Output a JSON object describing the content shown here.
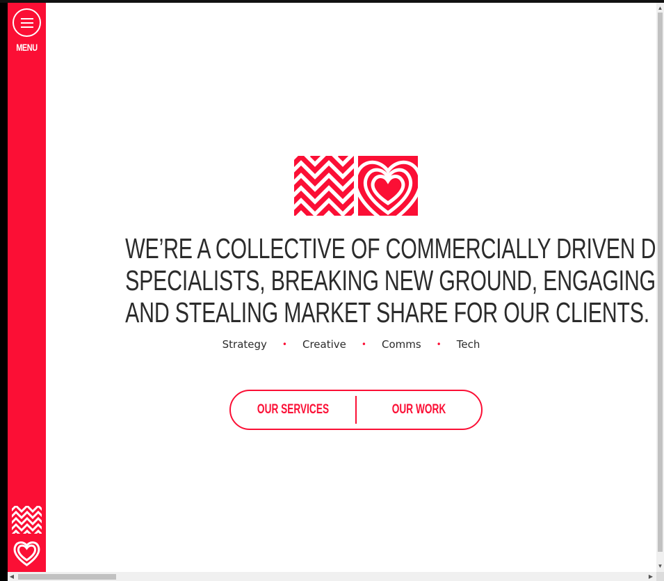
{
  "sidebar": {
    "menu_label": "MENU"
  },
  "hero": {
    "headline_lines": [
      "WE’RE A COLLECTIVE OF COMMERCIALLY DRIVEN DIGITAL",
      "SPECIALISTS, BREAKING NEW GROUND, ENGAGING END-USERS",
      "AND STEALING MARKET SHARE FOR OUR CLIENTS."
    ],
    "tags": [
      "Strategy",
      "Creative",
      "Comms",
      "Tech"
    ],
    "tag_separator": "•"
  },
  "cta": {
    "services_label": "OUR SERVICES",
    "work_label": "OUR WORK"
  },
  "icons": {
    "menu": "hamburger-icon",
    "logo_zigzag": "zigzag-logo-icon",
    "logo_heart": "heart-logo-icon",
    "scroll_up": "▲",
    "scroll_down": "▼",
    "scroll_left": "◀",
    "scroll_right": "▶"
  },
  "colors": {
    "brand": "#fb0f35",
    "text": "#2b2b2b"
  }
}
